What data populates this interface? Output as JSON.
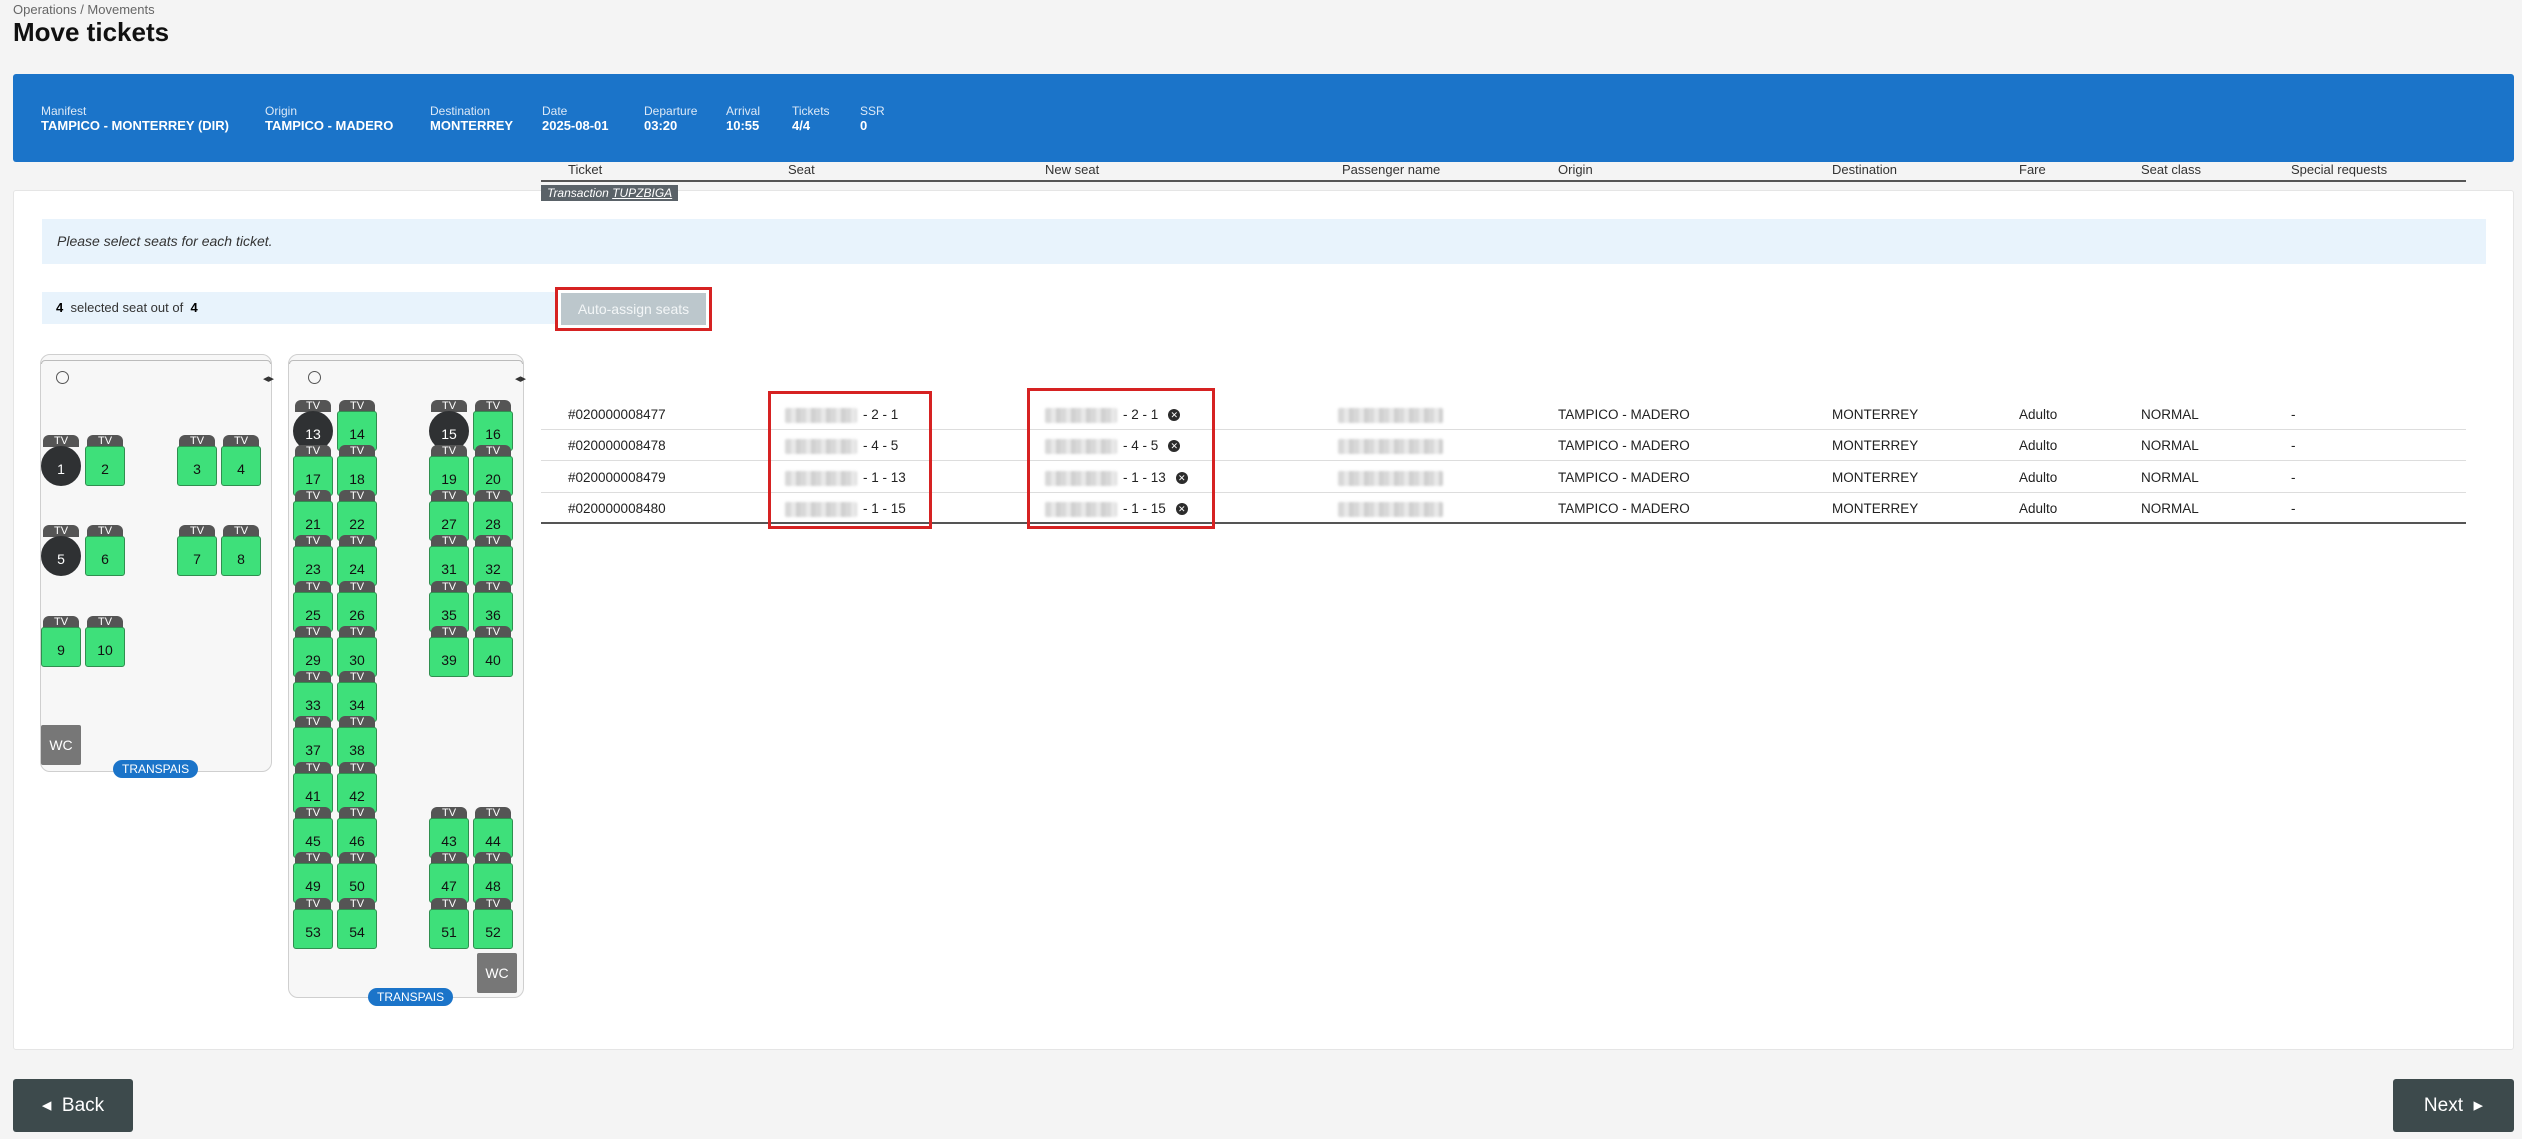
{
  "breadcrumb": "Operations / Movements",
  "title": "Move tickets",
  "info": [
    {
      "label": "Manifest",
      "value": "TAMPICO - MONTERREY (DIR)"
    },
    {
      "label": "Origin",
      "value": "TAMPICO - MADERO"
    },
    {
      "label": "Destination",
      "value": "MONTERREY"
    },
    {
      "label": "Date",
      "value": "2025-08-01"
    },
    {
      "label": "Departure",
      "value": "03:20"
    },
    {
      "label": "Arrival",
      "value": "10:55"
    },
    {
      "label": "Tickets",
      "value": "4/4"
    },
    {
      "label": "SSR",
      "value": "0"
    }
  ],
  "alert": "Please select seats for each ticket.",
  "selection": {
    "selected": "4",
    "mid": "selected seat out of",
    "total": "4"
  },
  "auto_assign_label": "Auto-assign seats",
  "seat_labels": {
    "tv": "TV",
    "wc": "WC",
    "brand": "TRANSPAIS",
    "arrows": "◂▸"
  },
  "deck1_seats": [
    {
      "n": "1",
      "occupied": true
    },
    {
      "n": "2"
    },
    {
      "n": "3"
    },
    {
      "n": "4"
    },
    {
      "n": "5",
      "occupied": true
    },
    {
      "n": "6"
    },
    {
      "n": "7"
    },
    {
      "n": "8"
    },
    {
      "n": "9"
    },
    {
      "n": "10"
    }
  ],
  "deck2_seats": [
    {
      "n": "13",
      "occupied": true
    },
    {
      "n": "14"
    },
    {
      "n": "15",
      "occupied": true
    },
    {
      "n": "16"
    },
    {
      "n": "17"
    },
    {
      "n": "18"
    },
    {
      "n": "19"
    },
    {
      "n": "20"
    },
    {
      "n": "21"
    },
    {
      "n": "22"
    },
    {
      "n": "27"
    },
    {
      "n": "28"
    },
    {
      "n": "23"
    },
    {
      "n": "24"
    },
    {
      "n": "31"
    },
    {
      "n": "32"
    },
    {
      "n": "25"
    },
    {
      "n": "26"
    },
    {
      "n": "35"
    },
    {
      "n": "36"
    },
    {
      "n": "29"
    },
    {
      "n": "30"
    },
    {
      "n": "39"
    },
    {
      "n": "40"
    },
    {
      "n": "33"
    },
    {
      "n": "34"
    },
    {
      "n": "37"
    },
    {
      "n": "38"
    },
    {
      "n": "41"
    },
    {
      "n": "42"
    },
    {
      "n": "45"
    },
    {
      "n": "46"
    },
    {
      "n": "43"
    },
    {
      "n": "44"
    },
    {
      "n": "49"
    },
    {
      "n": "50"
    },
    {
      "n": "47"
    },
    {
      "n": "48"
    },
    {
      "n": "53"
    },
    {
      "n": "54"
    },
    {
      "n": "51"
    },
    {
      "n": "52"
    }
  ],
  "table": {
    "headers": [
      "Ticket",
      "Seat",
      "New seat",
      "Passenger name",
      "Origin",
      "Destination",
      "Fare",
      "Seat class",
      "Special requests"
    ],
    "transaction_label": "Transaction",
    "transaction_code": "TUPZBIGA",
    "rows": [
      {
        "ticket": "#020000008477",
        "seat": "- 2 - 1",
        "new_seat": "- 2 - 1",
        "origin": "TAMPICO - MADERO",
        "destination": "MONTERREY",
        "fare": "Adulto",
        "seat_class": "NORMAL",
        "special": "-"
      },
      {
        "ticket": "#020000008478",
        "seat": "- 4 - 5",
        "new_seat": "- 4 - 5",
        "origin": "TAMPICO - MADERO",
        "destination": "MONTERREY",
        "fare": "Adulto",
        "seat_class": "NORMAL",
        "special": "-"
      },
      {
        "ticket": "#020000008479",
        "seat": "- 1 - 13",
        "new_seat": "- 1 - 13",
        "origin": "TAMPICO - MADERO",
        "destination": "MONTERREY",
        "fare": "Adulto",
        "seat_class": "NORMAL",
        "special": "-"
      },
      {
        "ticket": "#020000008480",
        "seat": "- 1 - 15",
        "new_seat": "- 1 - 15",
        "origin": "TAMPICO - MADERO",
        "destination": "MONTERREY",
        "fare": "Adulto",
        "seat_class": "NORMAL",
        "special": "-"
      }
    ]
  },
  "back_label": "Back",
  "next_label": "Next",
  "colors": {
    "primary": "#1b74c9",
    "seat_free": "#3ee07a",
    "seat_occupied": "#2f3133",
    "highlight": "#d62222"
  }
}
